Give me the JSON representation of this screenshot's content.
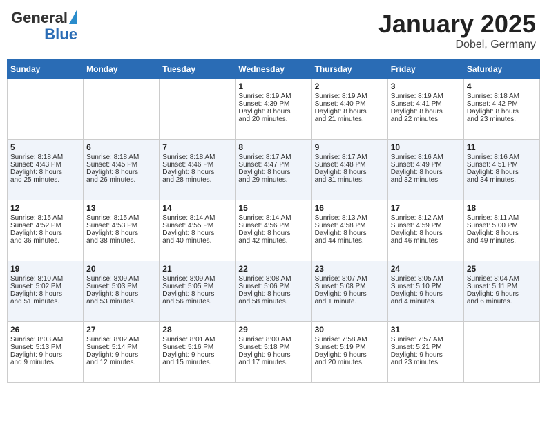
{
  "header": {
    "logo_line1": "General",
    "logo_line2": "Blue",
    "title": "January 2025",
    "subtitle": "Dobel, Germany"
  },
  "days_of_week": [
    "Sunday",
    "Monday",
    "Tuesday",
    "Wednesday",
    "Thursday",
    "Friday",
    "Saturday"
  ],
  "weeks": [
    [
      {
        "day": "",
        "content": ""
      },
      {
        "day": "",
        "content": ""
      },
      {
        "day": "",
        "content": ""
      },
      {
        "day": "1",
        "content": "Sunrise: 8:19 AM\nSunset: 4:39 PM\nDaylight: 8 hours\nand 20 minutes."
      },
      {
        "day": "2",
        "content": "Sunrise: 8:19 AM\nSunset: 4:40 PM\nDaylight: 8 hours\nand 21 minutes."
      },
      {
        "day": "3",
        "content": "Sunrise: 8:19 AM\nSunset: 4:41 PM\nDaylight: 8 hours\nand 22 minutes."
      },
      {
        "day": "4",
        "content": "Sunrise: 8:18 AM\nSunset: 4:42 PM\nDaylight: 8 hours\nand 23 minutes."
      }
    ],
    [
      {
        "day": "5",
        "content": "Sunrise: 8:18 AM\nSunset: 4:43 PM\nDaylight: 8 hours\nand 25 minutes."
      },
      {
        "day": "6",
        "content": "Sunrise: 8:18 AM\nSunset: 4:45 PM\nDaylight: 8 hours\nand 26 minutes."
      },
      {
        "day": "7",
        "content": "Sunrise: 8:18 AM\nSunset: 4:46 PM\nDaylight: 8 hours\nand 28 minutes."
      },
      {
        "day": "8",
        "content": "Sunrise: 8:17 AM\nSunset: 4:47 PM\nDaylight: 8 hours\nand 29 minutes."
      },
      {
        "day": "9",
        "content": "Sunrise: 8:17 AM\nSunset: 4:48 PM\nDaylight: 8 hours\nand 31 minutes."
      },
      {
        "day": "10",
        "content": "Sunrise: 8:16 AM\nSunset: 4:49 PM\nDaylight: 8 hours\nand 32 minutes."
      },
      {
        "day": "11",
        "content": "Sunrise: 8:16 AM\nSunset: 4:51 PM\nDaylight: 8 hours\nand 34 minutes."
      }
    ],
    [
      {
        "day": "12",
        "content": "Sunrise: 8:15 AM\nSunset: 4:52 PM\nDaylight: 8 hours\nand 36 minutes."
      },
      {
        "day": "13",
        "content": "Sunrise: 8:15 AM\nSunset: 4:53 PM\nDaylight: 8 hours\nand 38 minutes."
      },
      {
        "day": "14",
        "content": "Sunrise: 8:14 AM\nSunset: 4:55 PM\nDaylight: 8 hours\nand 40 minutes."
      },
      {
        "day": "15",
        "content": "Sunrise: 8:14 AM\nSunset: 4:56 PM\nDaylight: 8 hours\nand 42 minutes."
      },
      {
        "day": "16",
        "content": "Sunrise: 8:13 AM\nSunset: 4:58 PM\nDaylight: 8 hours\nand 44 minutes."
      },
      {
        "day": "17",
        "content": "Sunrise: 8:12 AM\nSunset: 4:59 PM\nDaylight: 8 hours\nand 46 minutes."
      },
      {
        "day": "18",
        "content": "Sunrise: 8:11 AM\nSunset: 5:00 PM\nDaylight: 8 hours\nand 49 minutes."
      }
    ],
    [
      {
        "day": "19",
        "content": "Sunrise: 8:10 AM\nSunset: 5:02 PM\nDaylight: 8 hours\nand 51 minutes."
      },
      {
        "day": "20",
        "content": "Sunrise: 8:09 AM\nSunset: 5:03 PM\nDaylight: 8 hours\nand 53 minutes."
      },
      {
        "day": "21",
        "content": "Sunrise: 8:09 AM\nSunset: 5:05 PM\nDaylight: 8 hours\nand 56 minutes."
      },
      {
        "day": "22",
        "content": "Sunrise: 8:08 AM\nSunset: 5:06 PM\nDaylight: 8 hours\nand 58 minutes."
      },
      {
        "day": "23",
        "content": "Sunrise: 8:07 AM\nSunset: 5:08 PM\nDaylight: 9 hours\nand 1 minute."
      },
      {
        "day": "24",
        "content": "Sunrise: 8:05 AM\nSunset: 5:10 PM\nDaylight: 9 hours\nand 4 minutes."
      },
      {
        "day": "25",
        "content": "Sunrise: 8:04 AM\nSunset: 5:11 PM\nDaylight: 9 hours\nand 6 minutes."
      }
    ],
    [
      {
        "day": "26",
        "content": "Sunrise: 8:03 AM\nSunset: 5:13 PM\nDaylight: 9 hours\nand 9 minutes."
      },
      {
        "day": "27",
        "content": "Sunrise: 8:02 AM\nSunset: 5:14 PM\nDaylight: 9 hours\nand 12 minutes."
      },
      {
        "day": "28",
        "content": "Sunrise: 8:01 AM\nSunset: 5:16 PM\nDaylight: 9 hours\nand 15 minutes."
      },
      {
        "day": "29",
        "content": "Sunrise: 8:00 AM\nSunset: 5:18 PM\nDaylight: 9 hours\nand 17 minutes."
      },
      {
        "day": "30",
        "content": "Sunrise: 7:58 AM\nSunset: 5:19 PM\nDaylight: 9 hours\nand 20 minutes."
      },
      {
        "day": "31",
        "content": "Sunrise: 7:57 AM\nSunset: 5:21 PM\nDaylight: 9 hours\nand 23 minutes."
      },
      {
        "day": "",
        "content": ""
      }
    ]
  ]
}
